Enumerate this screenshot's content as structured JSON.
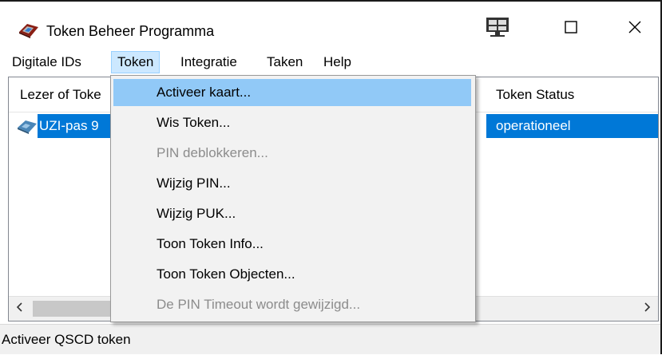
{
  "window": {
    "title": "Token Beheer Programma",
    "icons": {
      "app": "token-card-icon",
      "remote": "remote-desktop-icon",
      "maximize": "maximize-icon",
      "close": "close-icon"
    }
  },
  "menu": {
    "items": [
      {
        "label": "Digitale IDs"
      },
      {
        "label": "Token",
        "active": true
      },
      {
        "label": "Integratie"
      },
      {
        "label": "Taken"
      },
      {
        "label": "Help"
      }
    ]
  },
  "list": {
    "columns": [
      "Lezer of Toke",
      "Token Status"
    ],
    "rows": [
      {
        "name": "UZI-pas 9",
        "status": "operationeel",
        "icon": "smart-card-icon",
        "selected": true
      }
    ]
  },
  "dropdown": {
    "items": [
      {
        "label": "Activeer kaart...",
        "enabled": true,
        "highlighted": true
      },
      {
        "label": "Wis Token...",
        "enabled": true
      },
      {
        "label": "PIN deblokkeren...",
        "enabled": false
      },
      {
        "label": "Wijzig PIN...",
        "enabled": true
      },
      {
        "label": "Wijzig PUK...",
        "enabled": true
      },
      {
        "label": "Toon Token Info...",
        "enabled": true
      },
      {
        "label": "Toon Token Objecten...",
        "enabled": true
      },
      {
        "label": "De PIN Timeout wordt gewijzigd...",
        "enabled": false
      }
    ]
  },
  "status": {
    "text": "Activeer QSCD token"
  },
  "colors": {
    "selection": "#0078d7",
    "menu_hover": "#91c9f7",
    "menu_active": "#cce8ff",
    "disabled_text": "#8c8c8c"
  }
}
